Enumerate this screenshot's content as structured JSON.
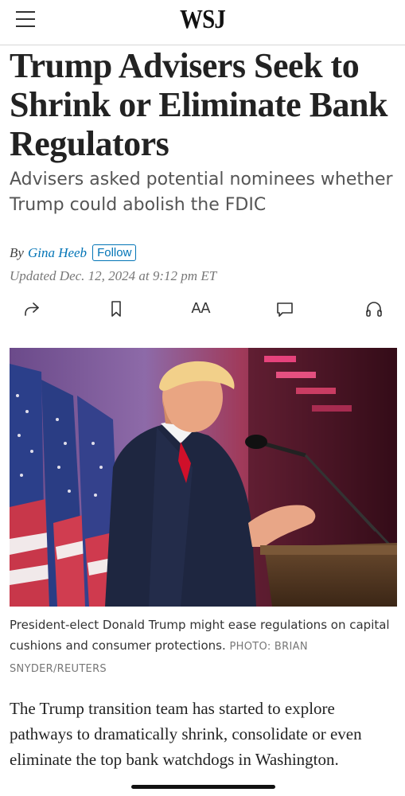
{
  "header": {
    "logo": "WSJ",
    "menu_icon": "hamburger-menu-icon"
  },
  "article": {
    "headline": "Trump Advisers Seek to Shrink or Eliminate Bank Regulators",
    "subhead": "Advisers asked potential nominees whether Trump could abolish the FDIC",
    "byline_prefix": "By",
    "author": "Gina Heeb",
    "follow_label": "Follow",
    "updated": "Updated Dec. 12, 2024 at 9:12 pm ET",
    "image_caption": "President-elect Donald Trump might ease regulations on capital cushions and consumer protections.",
    "image_credit": "PHOTO: BRIAN SNYDER/REUTERS",
    "body_first_paragraph": "The Trump transition team has started to explore pathways to dramatically shrink, consolidate or even eliminate the top bank watchdogs in Washington."
  },
  "toolbar": {
    "share_icon": "share-icon",
    "bookmark_icon": "bookmark-icon",
    "text_size_label": "AA",
    "comments_icon": "comment-icon",
    "listen_icon": "headphones-icon"
  },
  "colors": {
    "link": "#0274b6",
    "headline": "#222222",
    "subhead": "#555555",
    "meta": "#777777"
  }
}
